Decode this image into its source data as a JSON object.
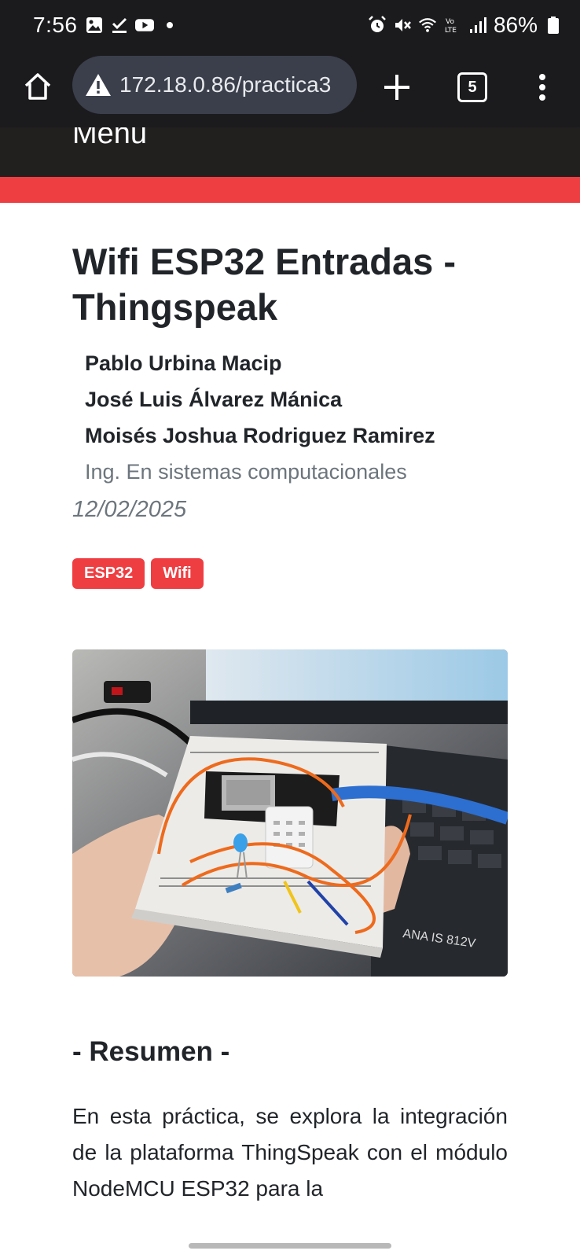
{
  "status_bar": {
    "time": "7:56",
    "battery": "86%",
    "left_icons": [
      "gallery-icon",
      "checkmark-icon",
      "youtube-icon",
      "dot-icon"
    ],
    "right_icons": [
      "alarm-icon",
      "mute-icon",
      "wifi-icon",
      "volte-icon",
      "signal-icon",
      "battery-icon"
    ]
  },
  "browser": {
    "url": "172.18.0.86/practica3",
    "tab_count": "5"
  },
  "site": {
    "nav_label": "Menu",
    "accent_color": "#ef3e42"
  },
  "article": {
    "title": "Wifi ESP32 Entradas - Thingspeak",
    "authors": [
      "Pablo Urbina Macip",
      "José Luis Álvarez Mánica",
      "Moisés Joshua Rodriguez Ramirez"
    ],
    "career": "Ing. En sistemas computacionales",
    "date": "12/02/2025",
    "tags": [
      "ESP32",
      "Wifi"
    ],
    "section_title": "- Resumen -",
    "summary": "En esta práctica, se explora la integración de la plataforma ThingSpeak con el módulo NodeMCU ESP32 para la"
  }
}
